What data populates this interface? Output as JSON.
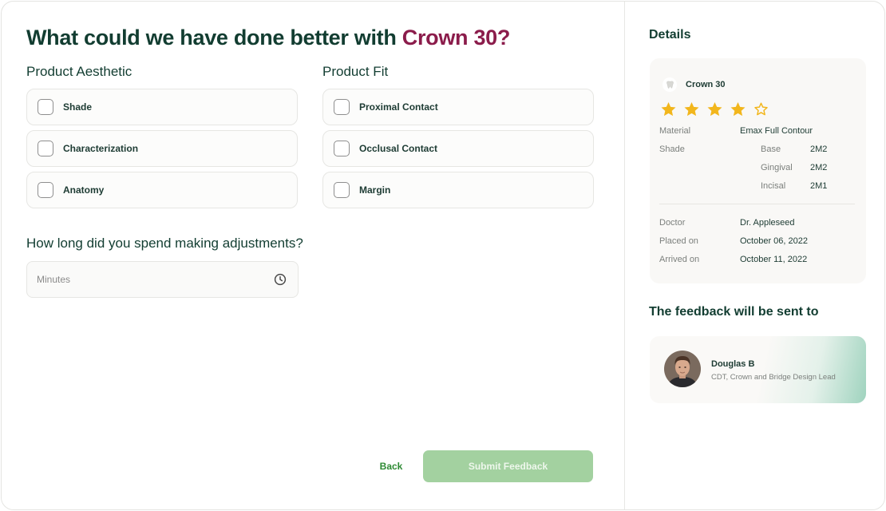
{
  "form": {
    "title_prefix": "What could we have done better with ",
    "title_product": "Crown 30?",
    "aesthetic": {
      "label": "Product Aesthetic",
      "options": [
        "Shade",
        "Characterization",
        "Anatomy"
      ]
    },
    "fit": {
      "label": "Product Fit",
      "options": [
        "Proximal Contact",
        "Occlusal Contact",
        "Margin"
      ]
    },
    "adjustment": {
      "question": "How long did you spend making adjustments?",
      "placeholder": "Minutes",
      "value": ""
    },
    "back_label": "Back",
    "submit_label": "Submit Feedback"
  },
  "details": {
    "title": "Details",
    "product": "Crown 30",
    "rating": {
      "value": 4,
      "max": 5
    },
    "material_label": "Material",
    "material_value": "Emax Full Contour",
    "shade_label": "Shade",
    "shades": [
      {
        "label": "Base",
        "value": "2M2"
      },
      {
        "label": "Gingival",
        "value": "2M2"
      },
      {
        "label": "Incisal",
        "value": "2M1"
      }
    ],
    "doctor_label": "Doctor",
    "doctor_value": "Dr. Appleseed",
    "placed_label": "Placed on",
    "placed_value": "October 06, 2022",
    "arrived_label": "Arrived on",
    "arrived_value": "October 11, 2022"
  },
  "recipient": {
    "title": "The feedback will be sent to",
    "name": "Douglas B",
    "role": "CDT, Crown and Bridge Design Lead"
  },
  "colors": {
    "accent": "#8b1c4b",
    "primary_text": "#123d31",
    "star": "#f2b61c",
    "submit_disabled": "#a3d1a0",
    "back_link": "#2e8a34"
  }
}
